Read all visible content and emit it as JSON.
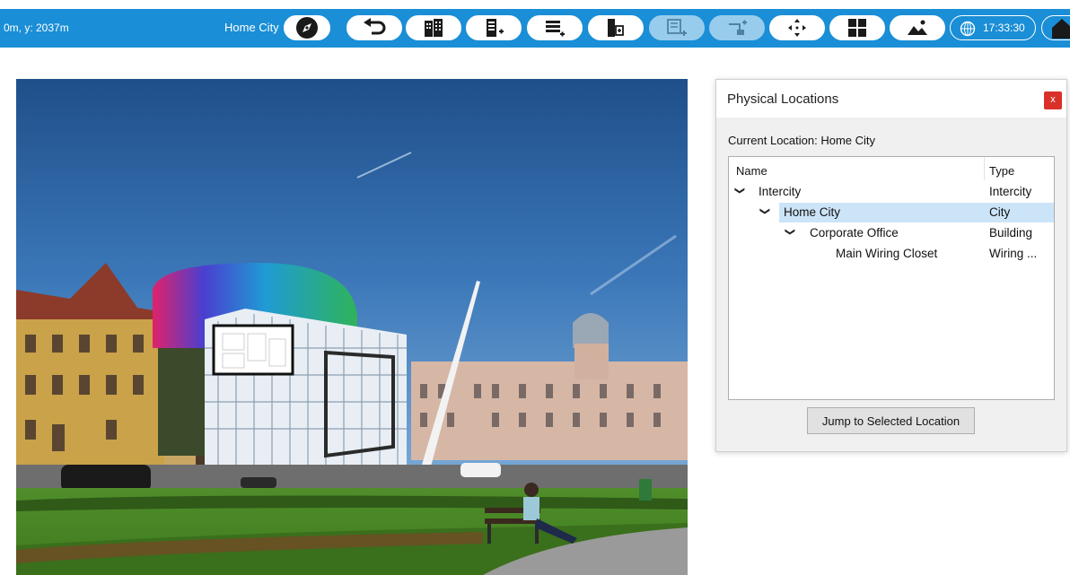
{
  "toolbar": {
    "coords": "0m, y: 2037m",
    "location_name": "Home City",
    "buttons": [
      {
        "icon": "compass-icon"
      },
      {
        "icon": "undo-arrow-icon"
      },
      {
        "icon": "building-icon"
      },
      {
        "icon": "add-rack-icon"
      },
      {
        "icon": "add-shelf-icon"
      },
      {
        "icon": "add-device-icon"
      },
      {
        "icon": "add-panel-icon-disabled"
      },
      {
        "icon": "add-link-icon-disabled"
      },
      {
        "icon": "move-arrows-icon"
      },
      {
        "icon": "grid-layout-icon"
      },
      {
        "icon": "landscape-image-icon"
      }
    ],
    "clock": "17:33:30",
    "clock_icon": "globe-clock-icon",
    "home_icon": "home-icon",
    "colors": {
      "bar": "#1a8ed6",
      "icon": "#1a1a1a"
    }
  },
  "dialog": {
    "title": "Physical Locations",
    "close_label": "x",
    "current_location": "Current Location: Home City",
    "columns": {
      "name": "Name",
      "type": "Type"
    },
    "rows": [
      {
        "name": "Intercity",
        "type": "Intercity",
        "level": 0,
        "expanded": true,
        "selected": false
      },
      {
        "name": "Home City",
        "type": "City",
        "level": 1,
        "expanded": true,
        "selected": true
      },
      {
        "name": "Corporate Office",
        "type": "Building",
        "level": 2,
        "expanded": true,
        "selected": false
      },
      {
        "name": "Main Wiring Closet",
        "type": "Wiring ...",
        "level": 3,
        "expanded": false,
        "selected": false
      }
    ],
    "jump_button": "Jump to Selected Location",
    "colors": {
      "selection": "#cce4f7",
      "close": "#d9302a"
    }
  }
}
